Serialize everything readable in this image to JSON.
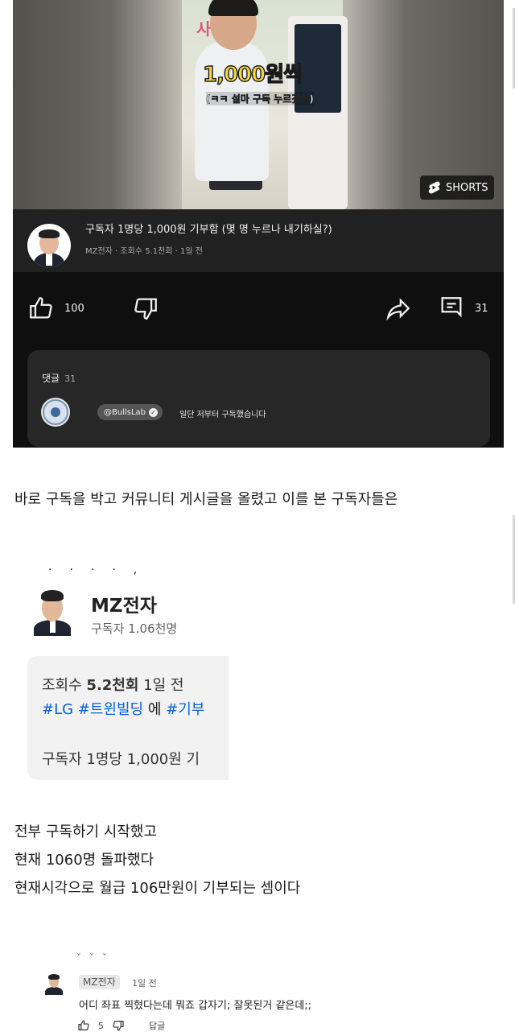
{
  "video": {
    "overlay_big": "1,000원씩",
    "overlay_small": "(ㅋㅋ 설마 구독 누르겠어)",
    "sign_text": "사랑",
    "shorts_label": "SHORTS",
    "title": "구독자 1명당 1,000원 기부함 (몇 명 누르나 내기하실?)",
    "meta": "MZ전자 · 조회수 5.1천회 · 1일 전",
    "like_count": "100",
    "comment_count": "31",
    "icons": [
      "thumbs-up-icon",
      "thumbs-down-icon",
      "share-icon",
      "comment-icon",
      "shorts-logo-icon"
    ]
  },
  "comments_preview": {
    "label": "댓글",
    "count": "31",
    "handle": "@BullsLab",
    "text": "일단 저부터 구독했습니다"
  },
  "paragraph1": "바로 구독을 박고 커뮤니티 게시글을 올렸고 이를 본 구독자들은",
  "channel": {
    "name": "MZ전자",
    "subscribers": "구독자 1.06천명",
    "post_meta_prefix": "조회수",
    "post_views": "5.2천회",
    "post_time": "1일 전",
    "post_tag1": "#LG",
    "post_tag2": "#트윈빌딩",
    "post_tag_mid": "에",
    "post_tag3": "#기부",
    "post_body": "구독자 1명당 1,000원 기"
  },
  "paragraph2": {
    "line1": "전부 구독하기 시작했고",
    "line2": "현재 1060명 돌파했다",
    "line3": "현재시각으로 월급 106만원이 기부되는 셈이다"
  },
  "bottom_comment": {
    "handle": "MZ전자",
    "time": "1일 전",
    "text": "어디 좌표 찍혔다는데 뭐죠 갑자기; 잘못된거 같은데;;",
    "like_count": "5",
    "reply_label": "답글"
  }
}
